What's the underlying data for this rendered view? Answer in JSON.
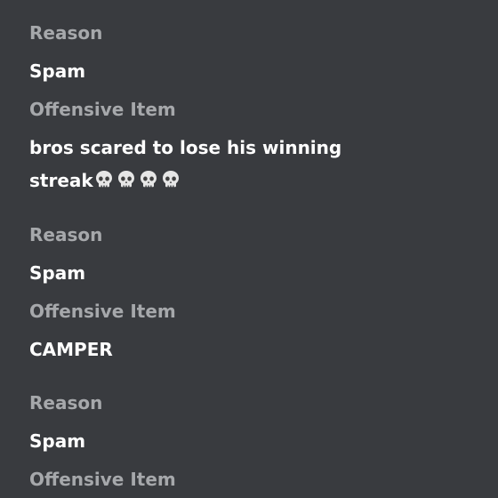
{
  "reports": [
    {
      "reason_label": "Reason",
      "reason_value": "Spam",
      "item_label": "Offensive Item",
      "item_line1": "bros scared  to lose his winning",
      "item_line2": "streak",
      "item_emojis": [
        "skull-icon",
        "skull-icon",
        "skull-icon",
        "skull-icon"
      ]
    },
    {
      "reason_label": "Reason",
      "reason_value": "Spam",
      "item_label": "Offensive Item",
      "item_value": "CAMPER"
    },
    {
      "reason_label": "Reason",
      "reason_value": "Spam",
      "item_label": "Offensive Item"
    }
  ],
  "colors": {
    "background": "#393b3f",
    "label": "#a6a8ab",
    "value": "#ffffff"
  }
}
